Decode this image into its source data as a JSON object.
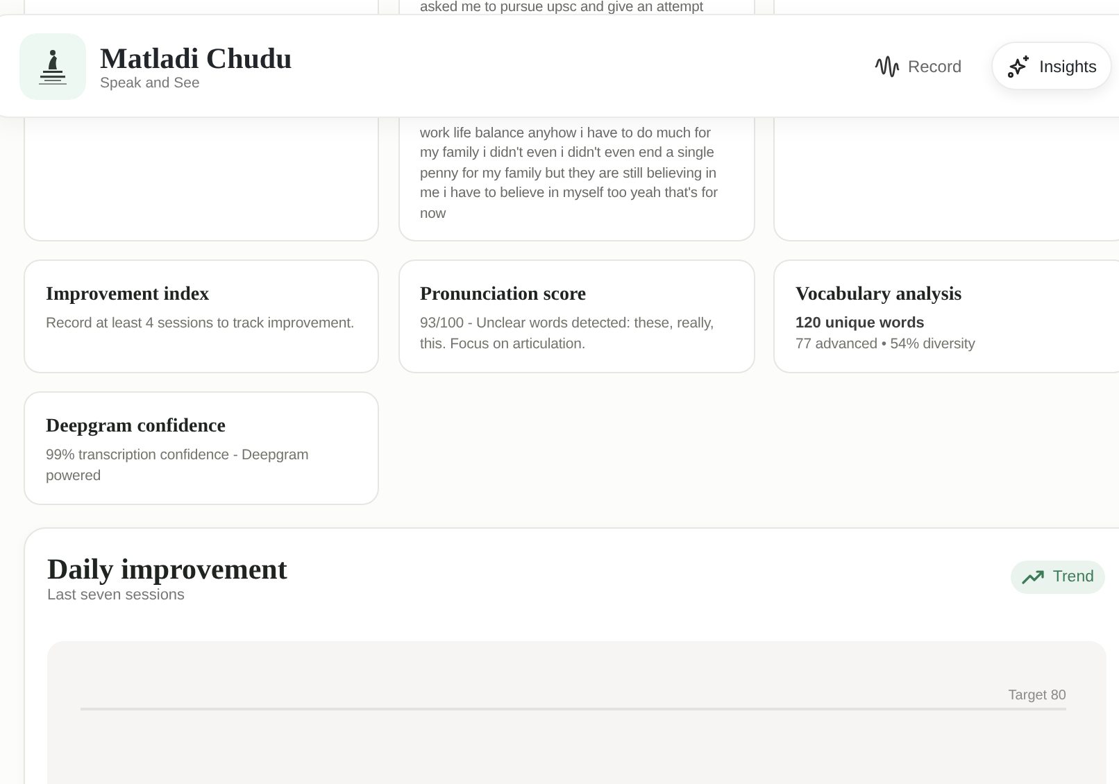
{
  "header": {
    "title": "Matladi Chudu",
    "subtitle": "Speak and See",
    "nav": [
      {
        "label": "Record",
        "selected": false
      },
      {
        "label": "Insights",
        "selected": true
      }
    ]
  },
  "top_cards": [
    {
      "kind": "blank"
    },
    {
      "kind": "transcript",
      "excerpt_start": "asked me to pursue upsc and give an attempt",
      "excerpt_end": "work life balance anyhow i have to do much for my family i didn't even i didn't even end a single penny for my family but they are still believing in me i have to believe in myself too yeah that's for now"
    },
    {
      "kind": "blank"
    }
  ],
  "metric_cards": [
    {
      "title": "Improvement index",
      "text": "Record at least 4 sessions to track improvement."
    },
    {
      "title": "Pronunciation score",
      "text": "93/100 - Unclear words detected: these, really, this. Focus on articulation."
    },
    {
      "title": "Vocabulary analysis",
      "highlight": "120 unique words",
      "text": "77 advanced • 54% diversity"
    },
    {
      "title": "Deepgram confidence",
      "text": "99% transcription confidence - Deepgram powered"
    }
  ],
  "daily": {
    "title": "Daily improvement",
    "subtitle": "Last seven sessions",
    "badge": "Trend",
    "target_label": "Target 80"
  }
}
